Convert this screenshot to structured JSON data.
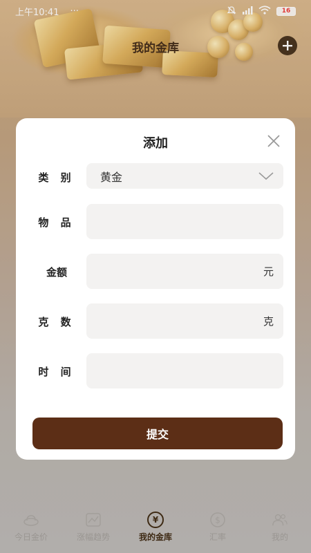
{
  "status_bar": {
    "time": "上午10:41",
    "dots": "···",
    "battery": "16"
  },
  "header": {
    "title": "我的金库",
    "add_icon": "plus-circle-icon"
  },
  "modal": {
    "title": "添加",
    "close_icon": "close-icon",
    "fields": {
      "category": {
        "label": "类 别",
        "value": "黄金"
      },
      "item": {
        "label": "物 品",
        "value": ""
      },
      "amount": {
        "label": "金额",
        "value": "",
        "unit": "元"
      },
      "grams": {
        "label": "克 数",
        "value": "",
        "unit": "克"
      },
      "time": {
        "label": "时 间",
        "value": ""
      }
    },
    "submit_label": "提交"
  },
  "tabs": [
    {
      "label": "今日金价",
      "icon": "gold-ingot-icon"
    },
    {
      "label": "涨幅趋势",
      "icon": "trend-chart-icon"
    },
    {
      "label": "我的金库",
      "icon": "yen-coin-icon"
    },
    {
      "label": "汇率",
      "icon": "dollar-coin-icon"
    },
    {
      "label": "我的",
      "icon": "users-icon"
    }
  ],
  "colors": {
    "accent": "#5c2e16",
    "active_tab": "#3e2a14",
    "inactive_tab": "#9a9692"
  }
}
